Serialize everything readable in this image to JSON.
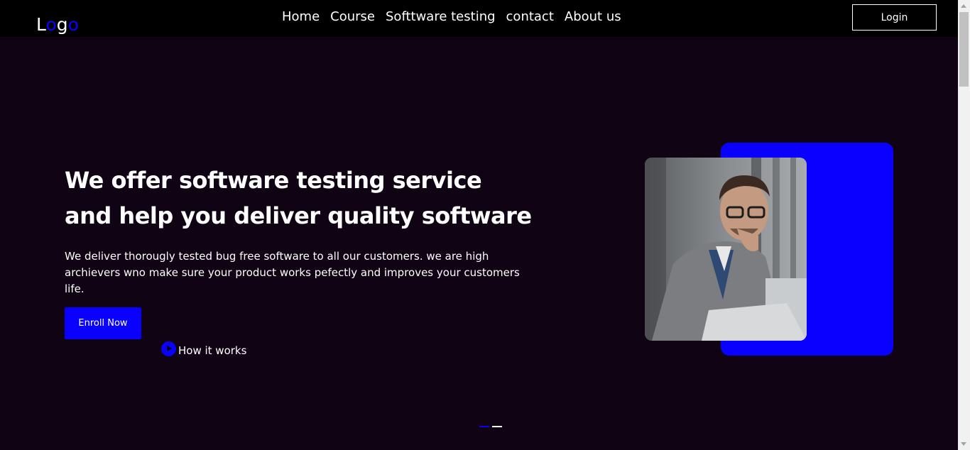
{
  "nav": {
    "logo": {
      "part1": "L",
      "part2": "o",
      "part3": "g",
      "part4": "o"
    },
    "links": [
      "Home",
      "Course",
      "Softtware testing",
      "contact",
      "About us"
    ],
    "login_label": "Login"
  },
  "hero": {
    "title": "We offer software testing service and help you deliver quality software",
    "description": "We deliver thorougly tested bug free software to all our customers. we are high archievers wno make sure your product works pefectly and improves your customers life.",
    "enroll_label": "Enroll Now",
    "how_label": "How it works"
  },
  "colors": {
    "accent": "#0a00ff",
    "background": "#100414",
    "navbar": "#000000"
  },
  "icons": {
    "play": "play-circle-icon"
  }
}
